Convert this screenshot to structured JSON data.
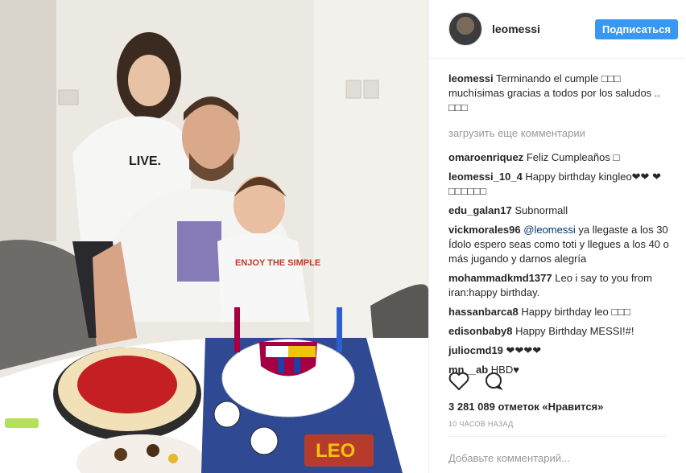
{
  "header": {
    "username": "leomessi",
    "follow_label": "Подписаться"
  },
  "caption": {
    "user": "leomessi",
    "text": "Terminando el cumple □□□ muchísimas gracias a todos por los saludos .. □□□"
  },
  "load_more": "загрузить еще комментарии",
  "comments": [
    {
      "user": "omaroenriquez",
      "text": "Feliz Cumpleaños □"
    },
    {
      "user": "leomessi_10_4",
      "text": "Happy birthday kingleo❤❤ ❤□□□□□□"
    },
    {
      "user": "edu_galan17",
      "text": "Subnormall"
    },
    {
      "user": "vickmorales96",
      "mention": "@leomessi",
      "text": " ya llegaste a los 30 Ídolo espero seas como toti y llegues a los 40 o más jugando y darnos alegría"
    },
    {
      "user": "mohammadkmd1377",
      "text": "Leo i say to you from iran:happy birthday."
    },
    {
      "user": "hassanbarca8",
      "text": "Happy birthday leo □□□"
    },
    {
      "user": "edisonbaby8",
      "text": "Happy Birthday MESSI!#!"
    },
    {
      "user": "juliocmd19",
      "text": "❤❤❤❤"
    },
    {
      "user": "mn__ab",
      "text": "HBD♥"
    }
  ],
  "likes": "3 281 089 отметок «Нравится»",
  "time": "10 часов назад",
  "add_comment_placeholder": "Добавьте комментарий...",
  "photo": {
    "cake_text": "LEO",
    "shirt_text": "ENJOY THE SIMPLE",
    "tshirt_text": "LIVE."
  }
}
